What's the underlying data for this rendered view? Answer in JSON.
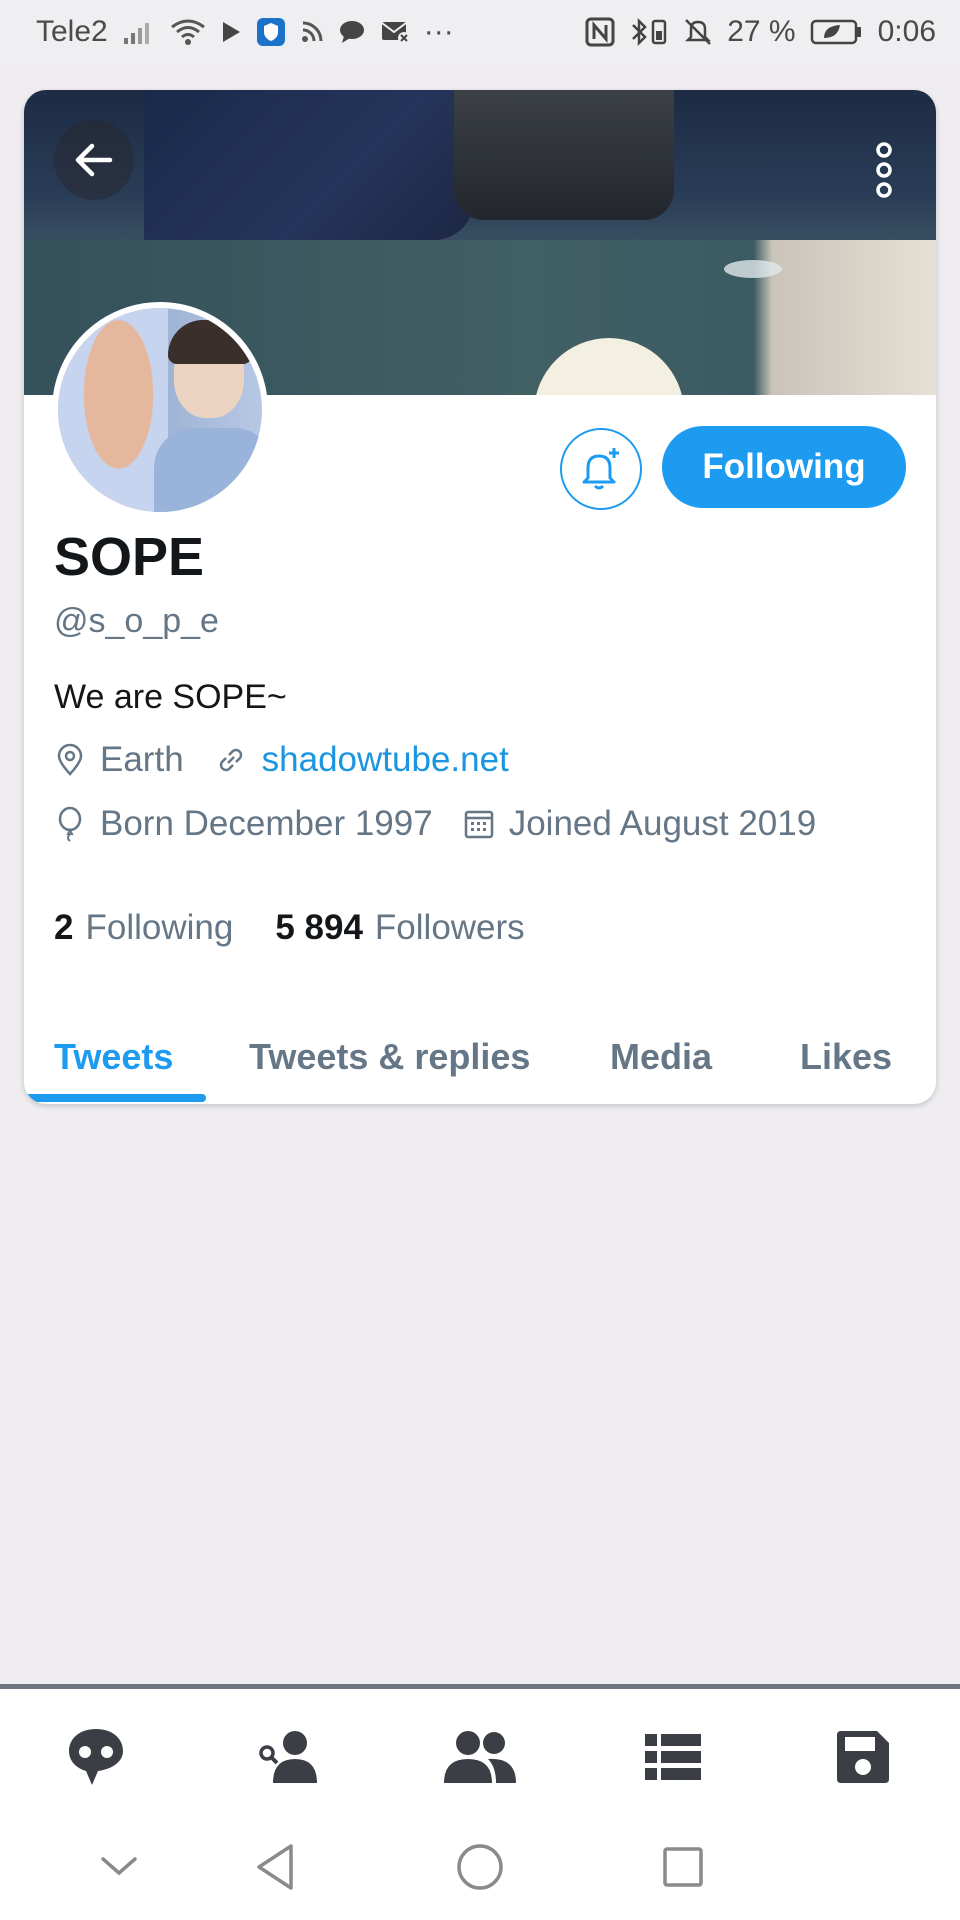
{
  "status_bar": {
    "carrier": "Tele2",
    "battery_percent": "27 %",
    "time": "0:06",
    "more": "···"
  },
  "profile": {
    "name": "SOPE",
    "handle": "@s_o_p_e",
    "bio": "We are SOPE~",
    "location": "Earth",
    "website": "shadowtube.net",
    "born": "Born December 1997",
    "joined": "Joined August 2019",
    "following_count": "2",
    "following_label": "Following",
    "followers_count": "5 894",
    "followers_label": "Followers",
    "follow_button_label": "Following"
  },
  "tabs": [
    {
      "label": "Tweets",
      "active": true
    },
    {
      "label": "Tweets & replies",
      "active": false
    },
    {
      "label": "Media",
      "active": false
    },
    {
      "label": "Likes",
      "active": false
    }
  ],
  "bottom_nav": [
    "speech-bubble-icon",
    "search-user-icon",
    "users-icon",
    "list-icon",
    "save-icon"
  ],
  "system_nav": [
    "chevron-down-icon",
    "back-triangle-icon",
    "home-circle-icon",
    "recents-square-icon"
  ],
  "colors": {
    "accent": "#1d9bf0",
    "text_secondary": "#657786",
    "background": "#efedf0"
  }
}
